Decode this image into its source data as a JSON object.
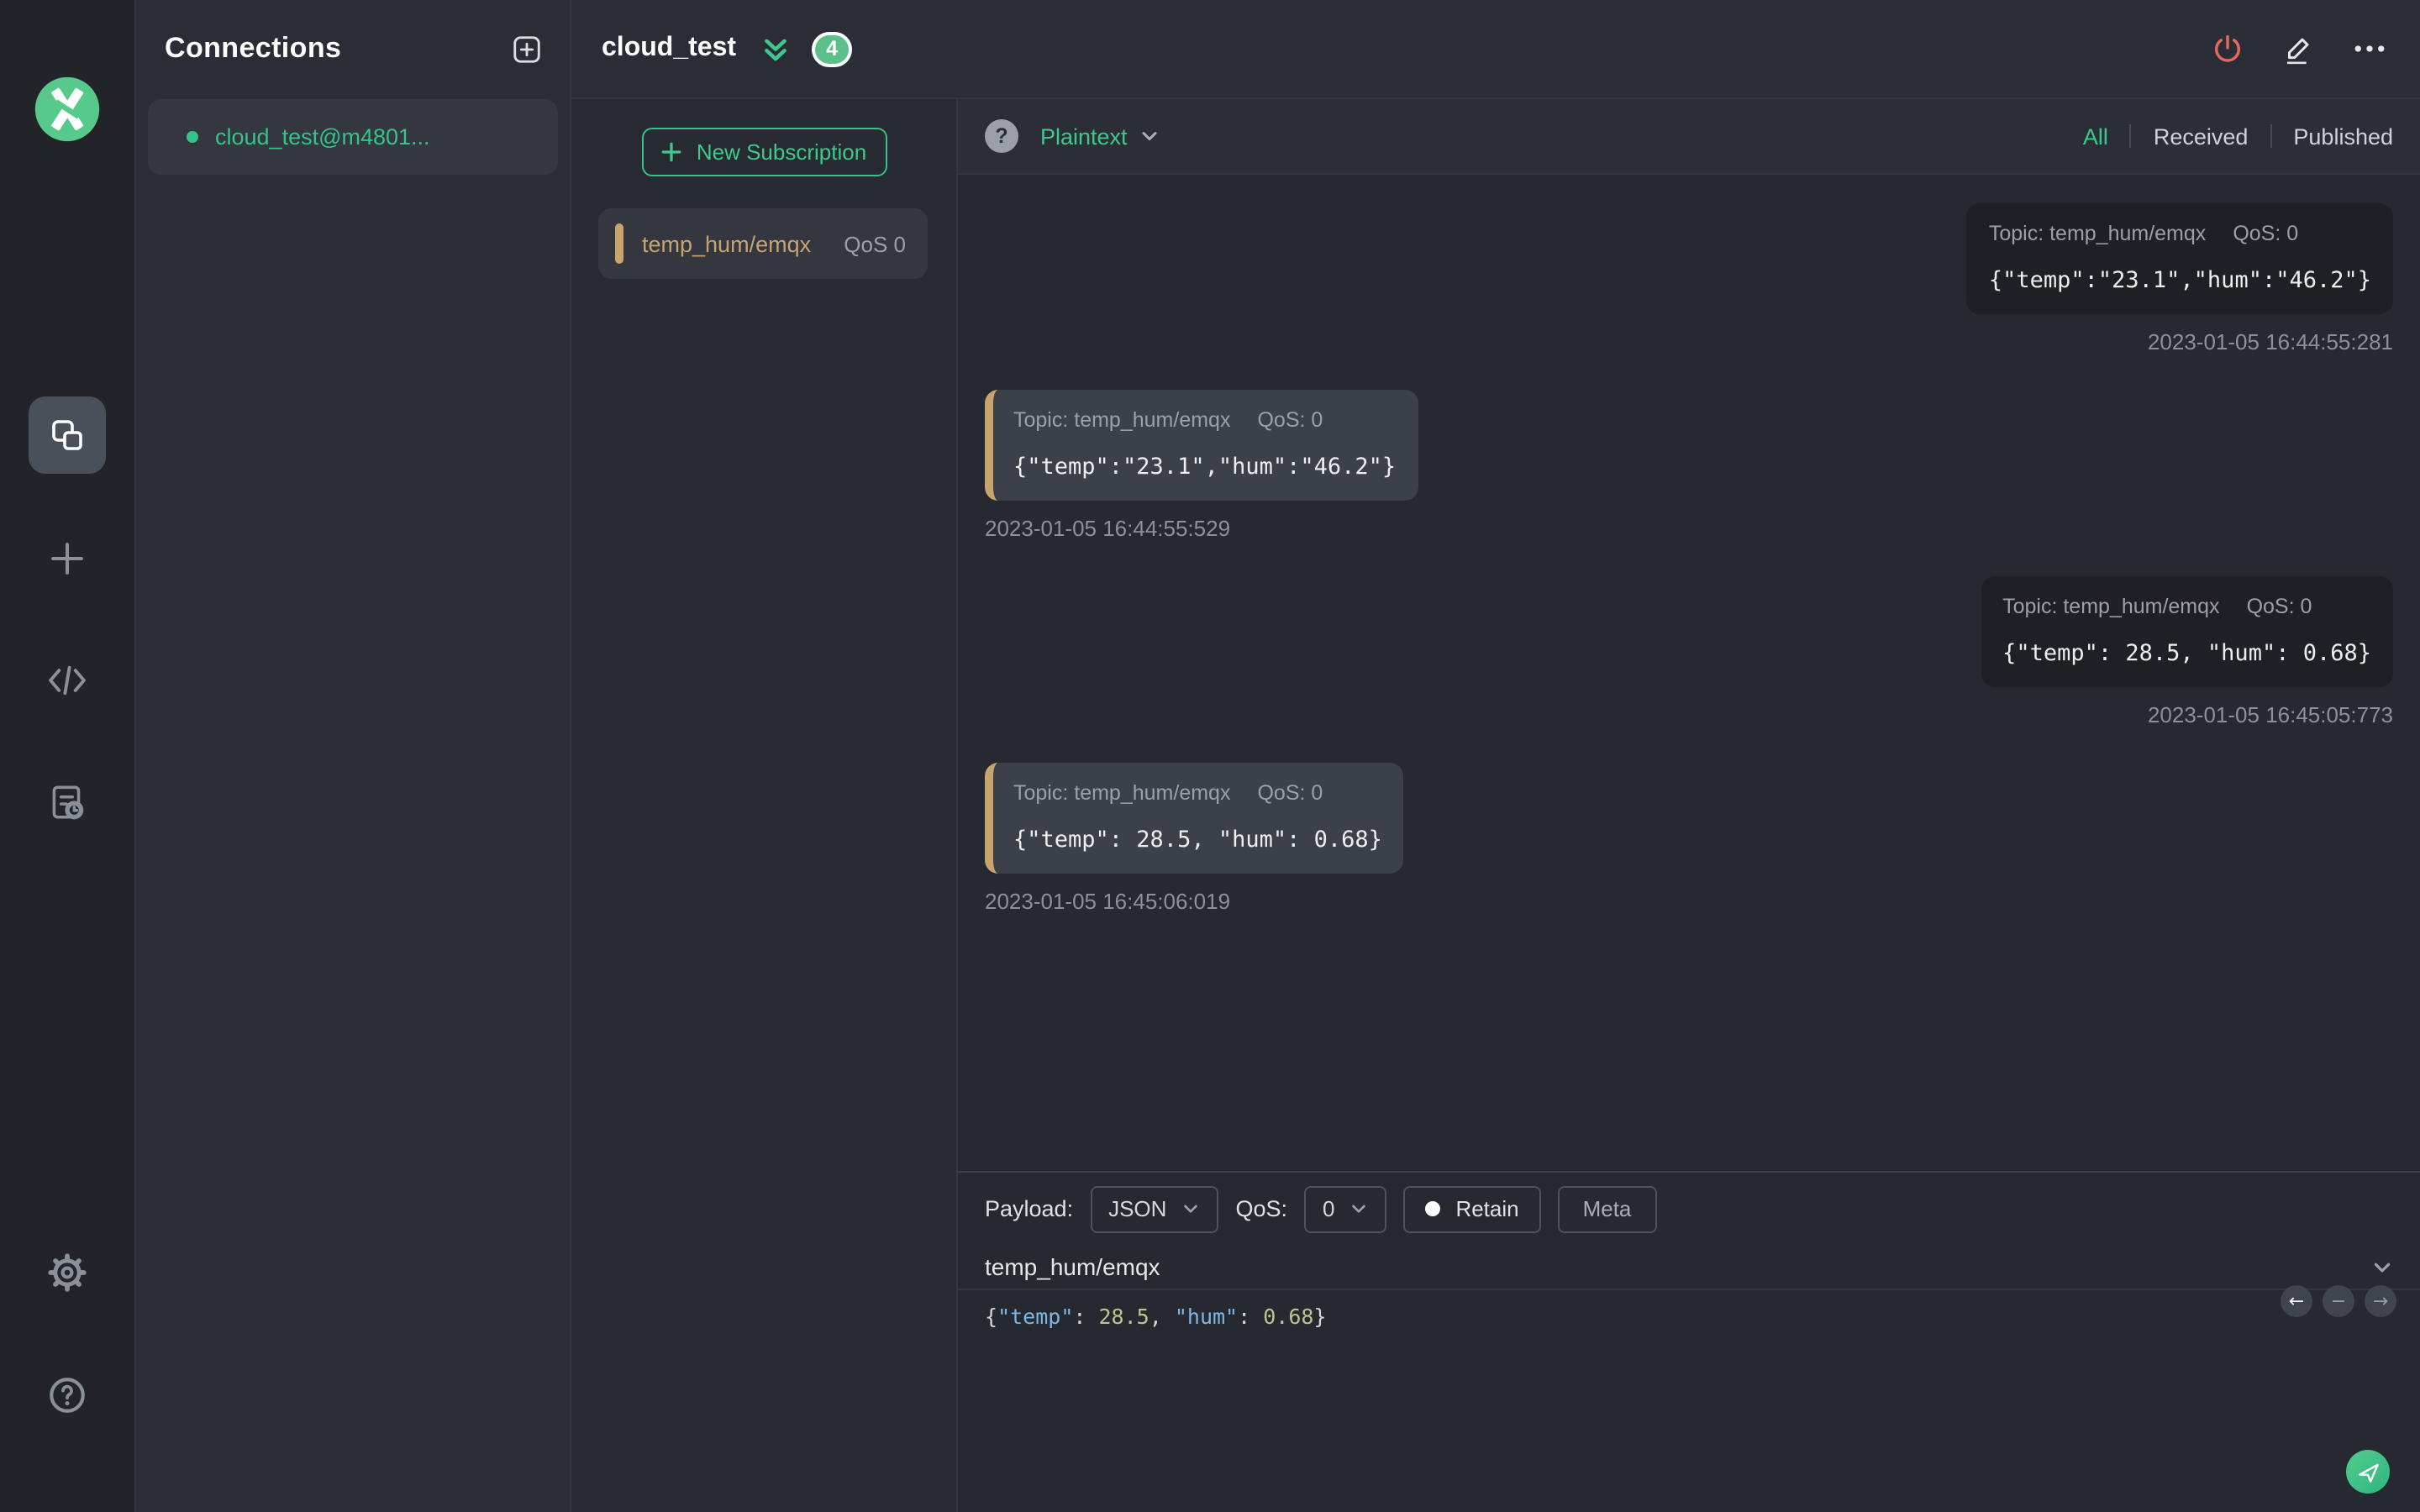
{
  "colors": {
    "accent_green": "#34c388",
    "danger_red": "#e0695f",
    "subscription_marker": "#c9a36d"
  },
  "connections_panel": {
    "title": "Connections",
    "items": [
      {
        "label": "cloud_test@m4801...",
        "status": "connected"
      }
    ]
  },
  "header": {
    "title": "cloud_test",
    "badge_count": "4"
  },
  "subscriptions": {
    "new_button_label": "New Subscription",
    "items": [
      {
        "topic": "temp_hum/emqx",
        "qos_label": "QoS 0"
      }
    ]
  },
  "toolbar": {
    "format_label": "Plaintext",
    "help_glyph": "?",
    "filters": [
      {
        "label": "All",
        "active": true
      },
      {
        "label": "Received",
        "active": false
      },
      {
        "label": "Published",
        "active": false
      }
    ]
  },
  "messages": [
    {
      "direction": "published",
      "topic_label": "Topic: temp_hum/emqx",
      "qos_label": "QoS: 0",
      "payload": "{\"temp\":\"23.1\",\"hum\":\"46.2\"}",
      "timestamp": "2023-01-05 16:44:55:281"
    },
    {
      "direction": "received",
      "topic_label": "Topic: temp_hum/emqx",
      "qos_label": "QoS: 0",
      "payload": "{\"temp\":\"23.1\",\"hum\":\"46.2\"}",
      "timestamp": "2023-01-05 16:44:55:529"
    },
    {
      "direction": "published",
      "topic_label": "Topic: temp_hum/emqx",
      "qos_label": "QoS: 0",
      "payload": "{\"temp\": 28.5, \"hum\": 0.68}",
      "timestamp": "2023-01-05 16:45:05:773"
    },
    {
      "direction": "received",
      "topic_label": "Topic: temp_hum/emqx",
      "qos_label": "QoS: 0",
      "payload": "{\"temp\": 28.5, \"hum\": 0.68}",
      "timestamp": "2023-01-05 16:45:06:019"
    }
  ],
  "publish": {
    "payload_label": "Payload:",
    "payload_type_value": "JSON",
    "qos_label": "QoS:",
    "qos_value": "0",
    "retain_label": "Retain",
    "meta_label": "Meta",
    "topic_value": "temp_hum/emqx",
    "editor_tokens": [
      {
        "t": "{",
        "c": "punct"
      },
      {
        "t": "\"temp\"",
        "c": "key"
      },
      {
        "t": ": ",
        "c": "punct"
      },
      {
        "t": "28.5",
        "c": "num"
      },
      {
        "t": ", ",
        "c": "punct"
      },
      {
        "t": "\"hum\"",
        "c": "key"
      },
      {
        "t": ": ",
        "c": "punct"
      },
      {
        "t": "0.68",
        "c": "num"
      },
      {
        "t": "}",
        "c": "punct"
      }
    ],
    "pager": {
      "prev": "←",
      "collapse": "−",
      "next": "→"
    }
  },
  "icons": [
    "mqttx-logo",
    "connections-icon",
    "new-connection-plus-icon",
    "script-code-icon",
    "log-icon",
    "settings-gear-icon",
    "help-icon",
    "add-connection-icon",
    "collapse-all-icon",
    "disconnect-power-icon",
    "edit-pencil-icon",
    "more-ellipsis-icon",
    "chevron-down-icon",
    "send-plane-icon"
  ]
}
